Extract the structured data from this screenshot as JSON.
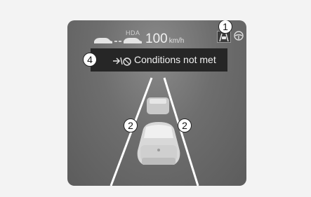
{
  "hud": {
    "hda_label": "HDA",
    "speed_value": "100",
    "speed_unit": "km/h"
  },
  "notification": {
    "message": "Conditions not met"
  },
  "callouts": {
    "lane_keeping_indicator": "1",
    "left_lane_line": "2",
    "right_lane_line": "2",
    "message_banner": "4"
  },
  "icons": {
    "lane_following_assist": "lane-following-assist-icon",
    "steering_wheel": "steering-wheel-icon",
    "lead_vehicle": "lead-vehicle-icon",
    "own_vehicle": "own-vehicle-icon"
  },
  "colors": {
    "cluster_background": "#6e6e6e",
    "banner_background": "#262626",
    "lane_lines": "#ffffff"
  }
}
